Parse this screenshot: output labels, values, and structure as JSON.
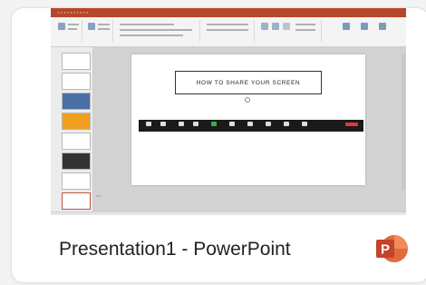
{
  "card": {
    "caption": "Presentation1 - PowerPoint",
    "app_icon": "powerpoint-icon",
    "icon_letter": "P"
  },
  "thumbnail": {
    "slide_title": "HOW TO SHARE YOUR SCREEN",
    "accent": "#b7472a"
  },
  "colors": {
    "ppt_red": "#c4543d",
    "ppt_orange": "#e26a3c"
  }
}
